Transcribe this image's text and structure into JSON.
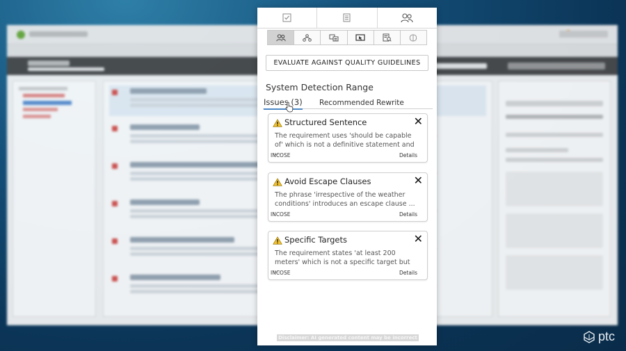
{
  "top_tabs": [
    {
      "icon": "checkbox-icon",
      "active": false
    },
    {
      "icon": "document-icon",
      "active": false
    },
    {
      "icon": "users-icon",
      "active": true
    }
  ],
  "sub_tabs": [
    {
      "icon": "users-icon",
      "active": true
    },
    {
      "icon": "hierarchy-icon",
      "active": false
    },
    {
      "icon": "compare-icon",
      "active": false
    },
    {
      "icon": "screen-cursor-icon",
      "active": false
    },
    {
      "icon": "document-search-icon",
      "active": false
    },
    {
      "icon": "brain-icon",
      "active": false
    }
  ],
  "evaluate_button": "EVALUATE AGAINST QUALITY GUIDELINES",
  "section_title": "System Detection Range",
  "result_tabs": {
    "issues": "Issues (3)",
    "rewrite": "Recommended Rewrite"
  },
  "issues": [
    {
      "title": "Structured Sentence",
      "description": "The requirement uses 'should be capable of' which is not a definitive statement and ...",
      "source": "INCOSE",
      "details": "Details"
    },
    {
      "title": "Avoid Escape Clauses",
      "description": "The phrase 'irrespective of the weather conditions' introduces an escape clause ...",
      "source": "INCOSE",
      "details": "Details"
    },
    {
      "title": "Specific Targets",
      "description": "The requirement states 'at least 200 meters' which is not a specific target but ...",
      "source": "INCOSE",
      "details": "Details"
    }
  ],
  "disclaimer": "Disclaimer: AI generated content may be incorrect",
  "brand": "ptc",
  "colors": {
    "accent_underline": "#4a86c5",
    "warning": "#f2c12e"
  }
}
